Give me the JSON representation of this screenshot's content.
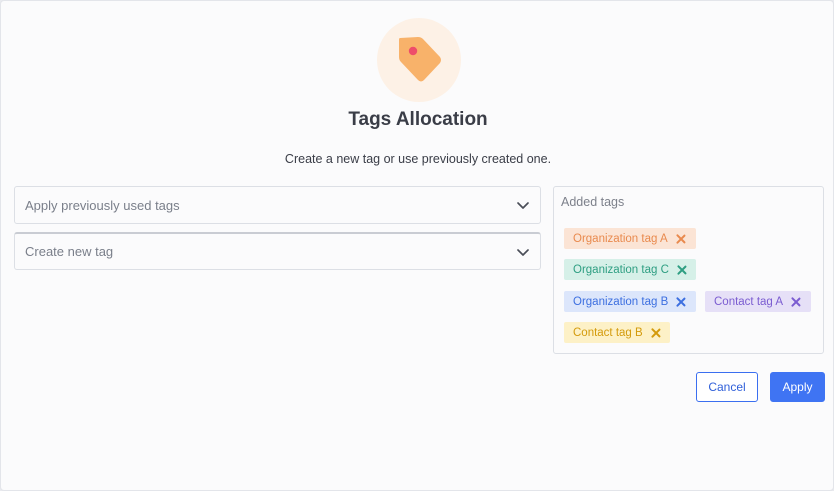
{
  "header": {
    "icon": "tag-icon",
    "title": "Tags Allocation",
    "subtitle": "Create a new tag or use previously created one."
  },
  "selects": {
    "previous_tags": {
      "label": "Apply previously used tags",
      "icon": "chevron-down-icon"
    },
    "new_tag": {
      "label": "Create new tag",
      "icon": "chevron-down-icon"
    }
  },
  "added": {
    "title": "Added tags",
    "tags": [
      {
        "label": "Organization tag A",
        "color": "#e98a4e",
        "bg": "#fbe4d5"
      },
      {
        "label": "Organization tag C",
        "color": "#2e9e82",
        "bg": "#d6f0e8"
      },
      {
        "label": "Organization tag B",
        "color": "#3c6fe0",
        "bg": "#dce6fb"
      },
      {
        "label": "Contact tag A",
        "color": "#7b5cd1",
        "bg": "#e6e0f7"
      },
      {
        "label": "Contact tag B",
        "color": "#d49b0c",
        "bg": "#fdf1c7"
      }
    ]
  },
  "actions": {
    "cancel": "Cancel",
    "apply": "Apply"
  },
  "colors": {
    "accent": "#3f74f3",
    "icon_bg": "#fdf1e6",
    "icon_tag": "#f8b26a",
    "icon_dot": "#ee4d6a"
  }
}
